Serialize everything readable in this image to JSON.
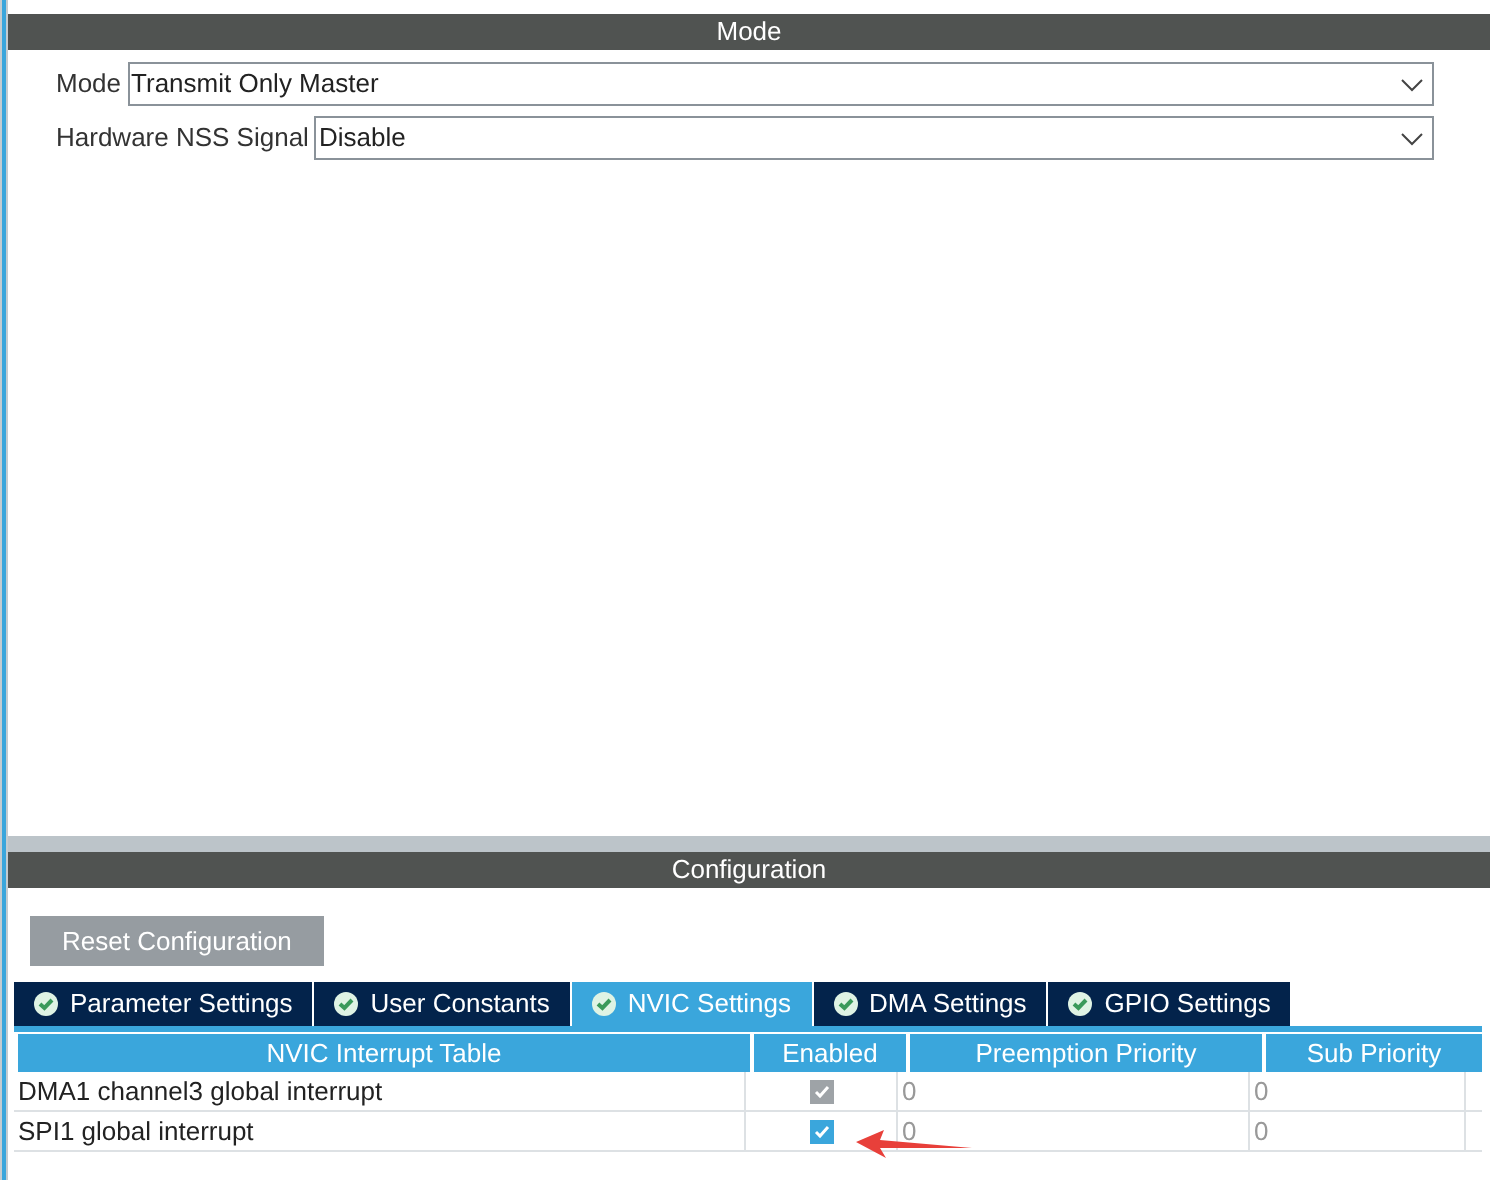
{
  "mode_panel": {
    "title": "Mode",
    "fields": [
      {
        "label": "Mode",
        "value": "Transmit Only Master"
      },
      {
        "label": "Hardware NSS Signal",
        "value": "Disable"
      }
    ]
  },
  "configuration": {
    "title": "Configuration",
    "reset_button": "Reset Configuration",
    "tabs": [
      {
        "label": "Parameter Settings",
        "selected": false
      },
      {
        "label": "User Constants",
        "selected": false
      },
      {
        "label": "NVIC Settings",
        "selected": true
      },
      {
        "label": "DMA Settings",
        "selected": false
      },
      {
        "label": "GPIO Settings",
        "selected": false
      }
    ],
    "table": {
      "columns": [
        "NVIC Interrupt Table",
        "Enabled",
        "Preemption Priority",
        "Sub Priority"
      ],
      "rows": [
        {
          "name": "DMA1 channel3 global interrupt",
          "checked": true,
          "disabled": true,
          "preemption": "0",
          "sub": "0"
        },
        {
          "name": "SPI1 global interrupt",
          "checked": true,
          "disabled": false,
          "preemption": "0",
          "sub": "0"
        }
      ]
    }
  }
}
